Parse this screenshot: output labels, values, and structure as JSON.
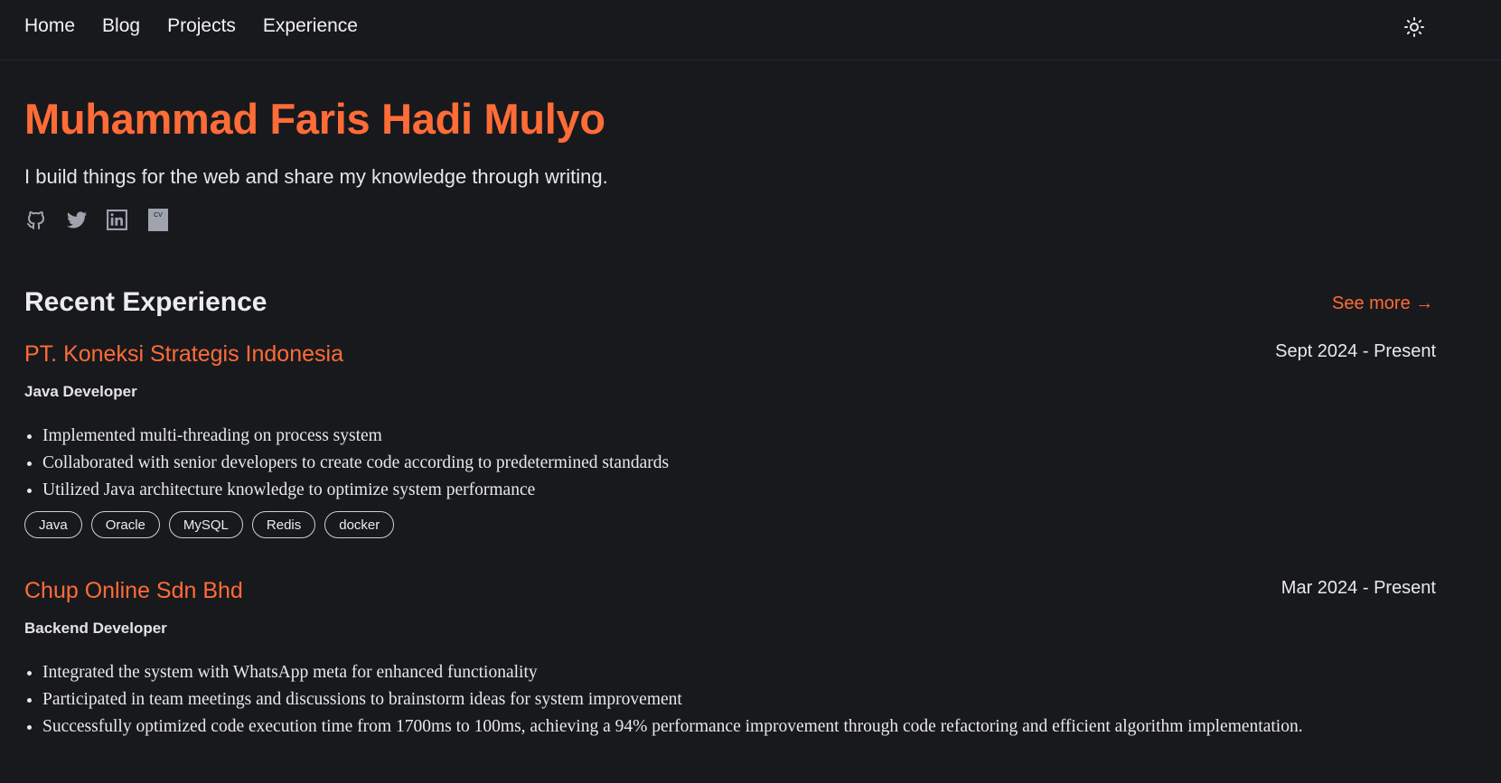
{
  "nav": {
    "links": [
      "Home",
      "Blog",
      "Projects",
      "Experience"
    ],
    "theme_icon": "sun-icon"
  },
  "hero": {
    "name": "Muhammad Faris Hadi Mulyo",
    "tagline": "I build things for the web and share my knowledge through writing.",
    "socials": [
      {
        "icon": "github-icon"
      },
      {
        "icon": "twitter-icon"
      },
      {
        "icon": "linkedin-icon"
      },
      {
        "icon": "cv-icon",
        "label": "CV"
      }
    ]
  },
  "experience_section": {
    "title": "Recent Experience",
    "see_more": "See more →",
    "items": [
      {
        "company": "PT. Koneksi Strategis Indonesia",
        "date": "Sept 2024 - Present",
        "role": "Java Developer",
        "bullets": [
          "Implemented multi-threading on process system",
          "Collaborated with senior developers to create code according to predetermined standards",
          "Utilized Java architecture knowledge to optimize system performance"
        ],
        "tags": [
          "Java",
          "Oracle",
          "MySQL",
          "Redis",
          "docker"
        ]
      },
      {
        "company": "Chup Online Sdn Bhd",
        "date": "Mar 2024 - Present",
        "role": "Backend Developer",
        "bullets": [
          "Integrated the system with WhatsApp meta for enhanced functionality",
          "Participated in team meetings and discussions to brainstorm ideas for system improvement",
          "Successfully optimized code execution time from 1700ms to 100ms, achieving a 94% performance improvement through code refactoring and efficient algorithm implementation."
        ]
      }
    ]
  },
  "colors": {
    "background": "#18191d",
    "accent": "#ff6c37",
    "icon": "#9ea3ae"
  }
}
